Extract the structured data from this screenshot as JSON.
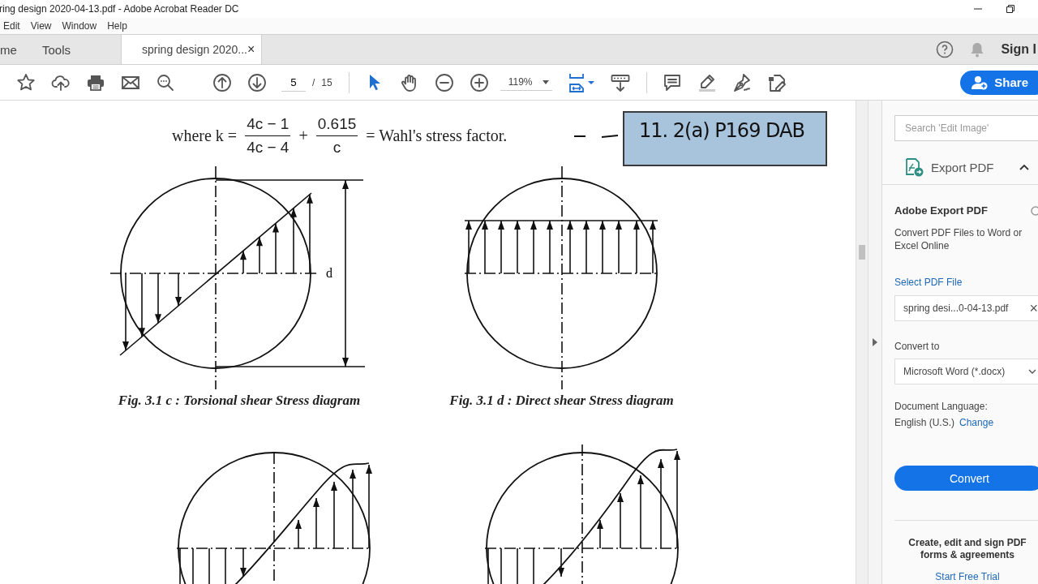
{
  "window": {
    "title": "ring design 2020-04-13.pdf - Adobe Acrobat Reader DC"
  },
  "menu": [
    "Edit",
    "View",
    "Window",
    "Help"
  ],
  "tabs": [
    {
      "label": "me",
      "selected": false
    },
    {
      "label": "Tools",
      "selected": false
    },
    {
      "label": "spring design 2020...",
      "selected": true,
      "close": "×"
    }
  ],
  "header": {
    "sign_in": "Sign I"
  },
  "toolbar": {
    "page_current": "5",
    "page_separator": "/",
    "page_total": "15",
    "zoom": "119%",
    "share_button": "Share"
  },
  "document": {
    "formula": {
      "lead": "where  k  =",
      "fractions": [
        {
          "numerator": "4c − 1",
          "denominator": "4c − 4"
        },
        {
          "numerator": "0.615",
          "denominator": "c"
        }
      ],
      "operator": "+",
      "tail": "= Wahl's stress factor."
    },
    "annotation": "11. 2(a) P169 DAB",
    "figures": [
      {
        "kind": "torsional",
        "caption": "Fig. 3.1 c : Torsional shear Stress diagram",
        "dimension_label": "d"
      },
      {
        "kind": "direct",
        "caption": "Fig. 3.1 d : Direct shear Stress diagram"
      }
    ],
    "lower_figures": [
      {
        "kind": "combined"
      },
      {
        "kind": "combined_offset"
      }
    ]
  },
  "tools_pane": {
    "search": {
      "placeholder": "Search 'Edit Image'"
    },
    "tool": {
      "label": "Export PDF",
      "expanded": true
    },
    "heading": "Adobe Export PDF",
    "description": "Convert PDF Files to Word or Excel Online",
    "select_link": "Select PDF File",
    "file": {
      "value": "spring desi...0-04-13.pdf",
      "clear": "×"
    },
    "convert_to_label": "Convert to",
    "convert_to": "Microsoft Word (*.docx)",
    "language_label": "Document Language:",
    "language": "English (U.S.)",
    "change_link": "Change",
    "convert_button": "Convert",
    "promo": "Create, edit and sign PDF forms & agreements",
    "trial_link": "Start Free Trial"
  }
}
